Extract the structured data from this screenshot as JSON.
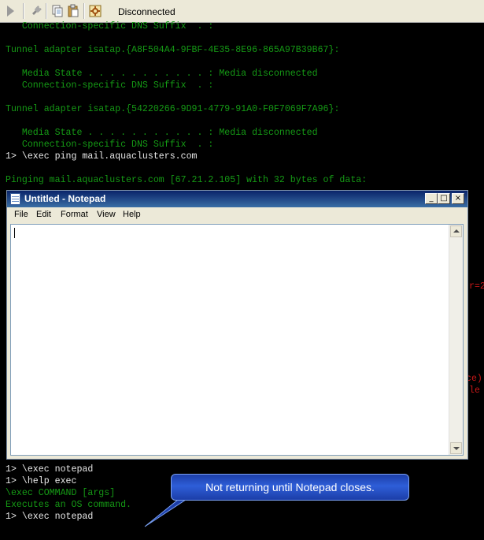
{
  "toolbar": {
    "status": "Disconnected",
    "icons": [
      "play-icon",
      "plug-icon",
      "copy-icon",
      "paste-icon",
      "settings-icon"
    ]
  },
  "console": {
    "lines_top": [
      {
        "text": "   Connection-specific DNS Suffix  . :",
        "color": "green"
      },
      {
        "text": "",
        "color": "green"
      },
      {
        "text": "Tunnel adapter isatap.{A8F504A4-9FBF-4E35-8E96-865A97B39B67}:",
        "color": "green"
      },
      {
        "text": "",
        "color": "green"
      },
      {
        "text": "   Media State . . . . . . . . . . . : Media disconnected",
        "color": "green"
      },
      {
        "text": "   Connection-specific DNS Suffix  . :",
        "color": "green"
      },
      {
        "text": "",
        "color": "green"
      },
      {
        "text": "Tunnel adapter isatap.{54220266-9D91-4779-91A0-F0F7069F7A96}:",
        "color": "green"
      },
      {
        "text": "",
        "color": "green"
      },
      {
        "text": "   Media State . . . . . . . . . . . : Media disconnected",
        "color": "green"
      },
      {
        "text": "   Connection-specific DNS Suffix  . :",
        "color": "green"
      },
      {
        "text": "1> \\exec ping mail.aquaclusters.com",
        "color": "white"
      },
      {
        "text": "",
        "color": "green"
      },
      {
        "text": "Pinging mail.aquaclusters.com [67.21.2.105] with 32 bytes of data:",
        "color": "green"
      }
    ],
    "lines_bottom": [
      {
        "text": "1> \\exec notepad",
        "color": "white"
      },
      {
        "text": "1> \\help exec",
        "color": "white"
      },
      {
        "text": "\\exec COMMAND [args]",
        "color": "green"
      },
      {
        "text": "Executes an OS command.",
        "color": "green"
      },
      {
        "text": "1> \\exec notepad",
        "color": "white"
      }
    ],
    "partial_right": [
      {
        "text": "r=2",
        "color": "red"
      },
      {
        "text": "ce)",
        "color": "red"
      },
      {
        "text": "le",
        "color": "red"
      }
    ]
  },
  "notepad": {
    "title": "Untitled - Notepad",
    "menu": [
      "File",
      "Edit",
      "Format",
      "View",
      "Help"
    ],
    "content": "",
    "buttons": {
      "minimize": "_",
      "maximize": "□",
      "close": "×"
    }
  },
  "callout": {
    "text": "Not returning until Notepad closes."
  }
}
